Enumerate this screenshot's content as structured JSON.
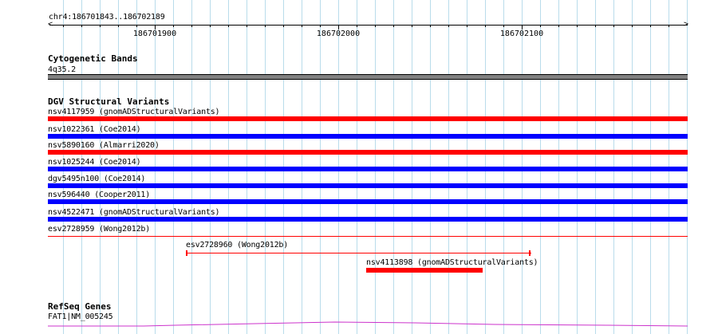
{
  "ruler": {
    "location": "chr4:186701843..186702189",
    "ticks": [
      "186701900",
      "186702000",
      "186702100"
    ]
  },
  "cytoband": {
    "title": "Cytogenetic Bands",
    "band": "4q35.2",
    "color": "#808080"
  },
  "dgv": {
    "title": "DGV Structural Variants",
    "rows": [
      {
        "label": "nsv4117959 (gnomADStructuralVariants)",
        "color": "#ff0000"
      },
      {
        "label": "nsv1022361 (Coe2014)",
        "color": "#0000ff"
      },
      {
        "label": "nsv5890160 (Almarri2020)",
        "color": "#ff0000"
      },
      {
        "label": "nsv1025244 (Coe2014)",
        "color": "#0000ff"
      },
      {
        "label": "dgv5495n100 (Coe2014)",
        "color": "#0000ff"
      },
      {
        "label": "nsv596440 (Cooper2011)",
        "color": "#0000ff"
      },
      {
        "label": "nsv4522471 (gnomADStructuralVariants)",
        "color": "#0000ff"
      },
      {
        "label": "esv2728959 (Wong2012b)",
        "color": "#ff0000"
      }
    ],
    "extra": [
      {
        "label": "esv2728960 (Wong2012b)",
        "color": "#ff0000"
      },
      {
        "label": "nsv4113898 (gnomADStructuralVariants)",
        "color": "#ff0000"
      }
    ]
  },
  "refseq": {
    "title": "RefSeq Genes",
    "gene": "FAT1|NM_005245",
    "color": "#cc33cc"
  }
}
